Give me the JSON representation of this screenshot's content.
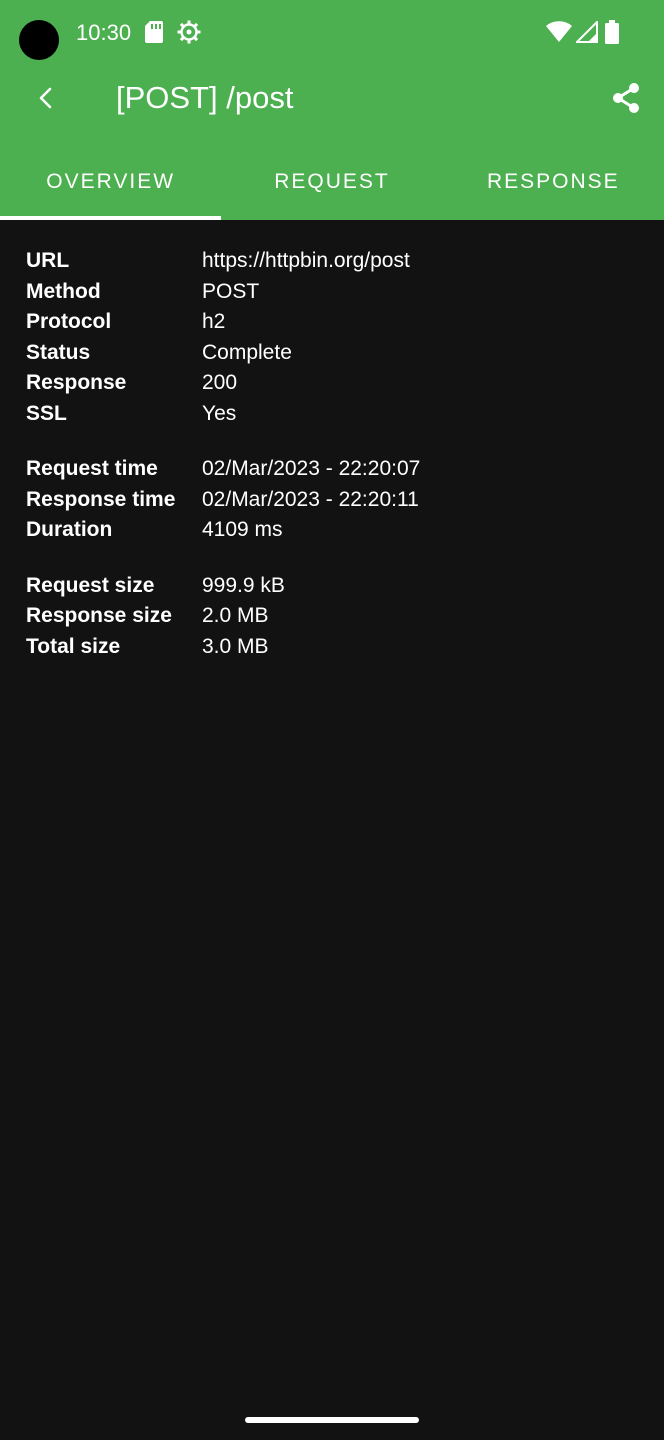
{
  "status_bar": {
    "time": "10:30",
    "icons": [
      "sd-card-icon",
      "gear-icon",
      "wifi-icon",
      "signal-icon",
      "battery-icon"
    ]
  },
  "toolbar": {
    "title": "[POST] /post",
    "back_icon": "chevron-left-icon",
    "share_icon": "share-icon"
  },
  "tabs": [
    {
      "label": "OVERVIEW",
      "active": true
    },
    {
      "label": "REQUEST",
      "active": false
    },
    {
      "label": "RESPONSE",
      "active": false
    }
  ],
  "overview": {
    "general": [
      {
        "label": "URL",
        "value": "https://httpbin.org/post"
      },
      {
        "label": "Method",
        "value": "POST"
      },
      {
        "label": "Protocol",
        "value": "h2"
      },
      {
        "label": "Status",
        "value": "Complete"
      },
      {
        "label": "Response",
        "value": "200"
      },
      {
        "label": "SSL",
        "value": "Yes"
      }
    ],
    "timing": [
      {
        "label": "Request time",
        "value": "02/Mar/2023 - 22:20:07"
      },
      {
        "label": "Response time",
        "value": "02/Mar/2023 - 22:20:11"
      },
      {
        "label": "Duration",
        "value": "4109 ms"
      }
    ],
    "sizes": [
      {
        "label": "Request size",
        "value": "999.9 kB"
      },
      {
        "label": "Response size",
        "value": "2.0 MB"
      },
      {
        "label": "Total size",
        "value": "3.0 MB"
      }
    ]
  },
  "colors": {
    "app_bar": "#4caf50",
    "background": "#121212",
    "text": "#ffffff"
  }
}
